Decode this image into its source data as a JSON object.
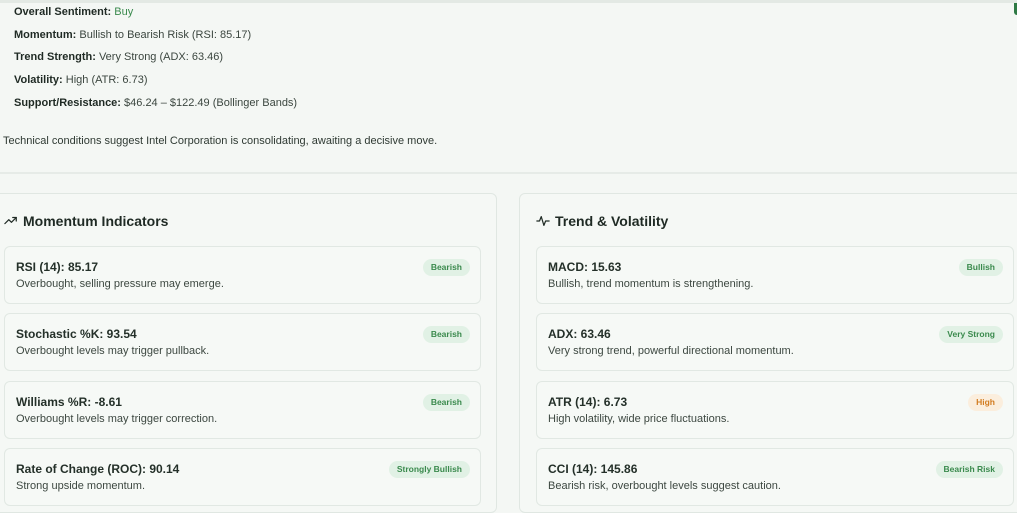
{
  "summary": {
    "sentiment_label": "Overall Sentiment:",
    "sentiment_value": "Buy",
    "momentum_label": "Momentum:",
    "momentum_value": "Bullish to Bearish Risk (RSI: 85.17)",
    "trend_label": "Trend Strength:",
    "trend_value": "Very Strong (ADX: 63.46)",
    "volatility_label": "Volatility:",
    "volatility_value": "High (ATR: 6.73)",
    "sr_label": "Support/Resistance:",
    "sr_value": "$46.24 – $122.49 (Bollinger Bands)",
    "description": "Technical conditions suggest Intel Corporation is consolidating, awaiting a decisive move."
  },
  "momentum_panel": {
    "title": "Momentum Indicators",
    "icon": "trending-up-icon",
    "cards": [
      {
        "title": "RSI (14): 85.17",
        "desc": "Overbought, selling pressure may emerge.",
        "badge": "Bearish",
        "badge_color": "#3a8a4d"
      },
      {
        "title": "Stochastic %K: 93.54",
        "desc": "Overbought levels may trigger pullback.",
        "badge": "Bearish",
        "badge_color": "#3a8a4d"
      },
      {
        "title": "Williams %R: -8.61",
        "desc": "Overbought levels may trigger correction.",
        "badge": "Bearish",
        "badge_color": "#3a8a4d"
      },
      {
        "title": "Rate of Change (ROC): 90.14",
        "desc": "Strong upside momentum.",
        "badge": "Strongly Bullish",
        "badge_color": "#3a8a4d"
      }
    ]
  },
  "trend_panel": {
    "title": "Trend & Volatility",
    "icon": "activity-icon",
    "cards": [
      {
        "title": "MACD: 15.63",
        "desc": "Bullish, trend momentum is strengthening.",
        "badge": "Bullish",
        "badge_color": "#3a8a4d"
      },
      {
        "title": "ADX: 63.46",
        "desc": "Very strong trend, powerful directional momentum.",
        "badge": "Very Strong",
        "badge_color": "#3a8a4d"
      },
      {
        "title": "ATR (14): 6.73",
        "desc": "High volatility, wide price fluctuations.",
        "badge": "High",
        "badge_color": "#d27d22"
      },
      {
        "title": "CCI (14): 145.86",
        "desc": "Bearish risk, overbought levels suggest caution.",
        "badge": "Bearish Risk",
        "badge_color": "#3a8a4d"
      }
    ]
  }
}
